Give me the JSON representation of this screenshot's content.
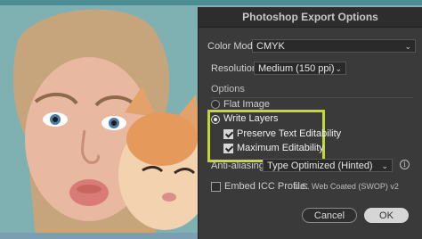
{
  "dialog": {
    "title": "Photoshop Export Options",
    "color_model": {
      "label": "Color Model:",
      "value": "CMYK"
    },
    "resolution": {
      "label": "Resolution:",
      "value": "Medium (150 ppi)"
    },
    "options_heading": "Options",
    "flat_image": {
      "label": "Flat Image",
      "selected": false
    },
    "write_layers": {
      "label": "Write Layers",
      "selected": true
    },
    "preserve_text": {
      "label": "Preserve Text Editability",
      "checked": true
    },
    "max_edit": {
      "label": "Maximum Editability",
      "checked": true
    },
    "anti_aliasing": {
      "label": "Anti-aliasing:",
      "value": "Type Optimized (Hinted)"
    },
    "embed_icc": {
      "label": "Embed ICC Profile:",
      "profile": "U.S. Web Coated (SWOP) v2",
      "checked": false
    },
    "buttons": {
      "cancel": "Cancel",
      "ok": "OK"
    },
    "highlight_color": "#c4d930"
  }
}
